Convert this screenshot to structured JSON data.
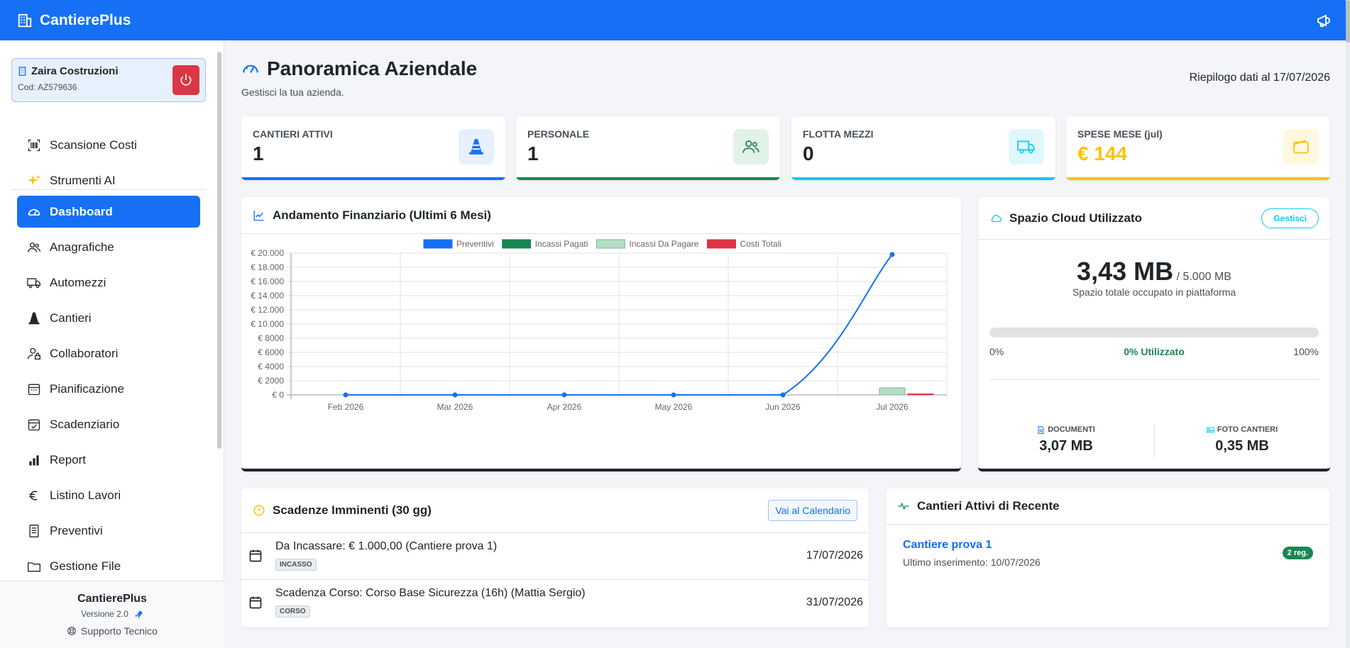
{
  "app": {
    "name": "CantierePlus"
  },
  "company": {
    "name": "Zaira Costruzioni",
    "code": "Cod: AZ579636"
  },
  "nav": {
    "items": [
      {
        "label": "Scansione Costi",
        "icon": "barcode-scan-icon"
      },
      {
        "label": "Strumenti AI",
        "icon": "sparkles-icon"
      },
      {
        "label": "Dashboard",
        "icon": "speedometer-icon",
        "active": true
      },
      {
        "label": "Anagrafiche",
        "icon": "people-icon"
      },
      {
        "label": "Automezzi",
        "icon": "truck-icon"
      },
      {
        "label": "Cantieri",
        "icon": "cone-icon"
      },
      {
        "label": "Collaboratori",
        "icon": "person-lock-icon"
      },
      {
        "label": "Pianificazione",
        "icon": "calendar-range-icon"
      },
      {
        "label": "Scadenziario",
        "icon": "calendar-check-icon"
      },
      {
        "label": "Report",
        "icon": "bar-chart-icon"
      },
      {
        "label": "Listino Lavori",
        "icon": "euro-icon"
      },
      {
        "label": "Preventivi",
        "icon": "file-text-icon"
      },
      {
        "label": "Gestione File",
        "icon": "folder-icon"
      }
    ]
  },
  "footer": {
    "title": "CantierePlus",
    "version": "Versione 2.0",
    "support": "Supporto Tecnico"
  },
  "header": {
    "title": "Panoramica Aziendale",
    "subtitle": "Gestisci la tua azienda.",
    "date": "Riepilogo dati al 17/07/2026"
  },
  "stats": [
    {
      "label": "CANTIERI ATTIVI",
      "value": "1",
      "color": "#1570f5",
      "icon": "cone-icon"
    },
    {
      "label": "PERSONALE",
      "value": "1",
      "color": "#198754",
      "icon": "people-icon"
    },
    {
      "label": "FLOTTA MEZZI",
      "value": "0",
      "color": "#0dcaf0",
      "icon": "truck-icon"
    },
    {
      "label": "SPESE MESE (jul)",
      "value": "€ 144",
      "color": "#ffc107",
      "icon": "wallet-icon"
    }
  ],
  "finance": {
    "title": "Andamento Finanziario (Ultimi 6 Mesi)"
  },
  "chart_data": {
    "type": "line",
    "title": "",
    "categories": [
      "Feb 2026",
      "Mar 2026",
      "Apr 2026",
      "May 2026",
      "Jun 2026",
      "Jul 2026"
    ],
    "ylim": [
      0,
      20000
    ],
    "yticks": [
      "€ 0",
      "€ 2000",
      "€ 4000",
      "€ 6000",
      "€ 8000",
      "€ 10.000",
      "€ 12.000",
      "€ 14.000",
      "€ 16.000",
      "€ 18.000",
      "€ 20.000"
    ],
    "series": [
      {
        "name": "Preventivi",
        "type": "line",
        "color": "#1570f5",
        "values": [
          0,
          0,
          0,
          0,
          0,
          19800
        ]
      },
      {
        "name": "Incassi Pagati",
        "type": "bar",
        "color": "#198754",
        "values": [
          0,
          0,
          0,
          0,
          0,
          0
        ]
      },
      {
        "name": "Incassi Da Pagare",
        "type": "bar",
        "color": "#b5dcc4",
        "stroke": "#7bb891",
        "values": [
          0,
          0,
          0,
          0,
          0,
          1000
        ]
      },
      {
        "name": "Costi Totali",
        "type": "bar",
        "color": "#dc3545",
        "values": [
          0,
          0,
          0,
          0,
          0,
          144
        ]
      }
    ],
    "grid": true,
    "legend": "top"
  },
  "cloud": {
    "title": "Spazio Cloud Utilizzato",
    "manage_label": "Gestisci",
    "used": "3,43 MB",
    "total": "/ 5.000 MB",
    "desc": "Spazio totale occupato in piattaforma",
    "percent_fill": 0,
    "min_label": "0%",
    "used_label": "0% Utilizzato",
    "max_label": "100%",
    "docs_label": "DOCUMENTI",
    "docs_value": "3,07 MB",
    "photos_label": "FOTO CANTIERI",
    "photos_value": "0,35 MB"
  },
  "deadlines": {
    "title": "Scadenze Imminenti (30 gg)",
    "calendar_button": "Vai al Calendario",
    "items": [
      {
        "text": "Da Incassare: € 1.000,00 (Cantiere prova 1)",
        "tag": "INCASSO",
        "date": "17/07/2026"
      },
      {
        "text": "Scadenza Corso: Corso Base Sicurezza (16h) (Mattia Sergio)",
        "tag": "CORSO",
        "date": "31/07/2026"
      }
    ]
  },
  "recent": {
    "title": "Cantieri Attivi di Recente",
    "site": "Cantiere prova 1",
    "last": "Ultimo inserimento: 10/07/2026",
    "badge": "2 reg."
  }
}
